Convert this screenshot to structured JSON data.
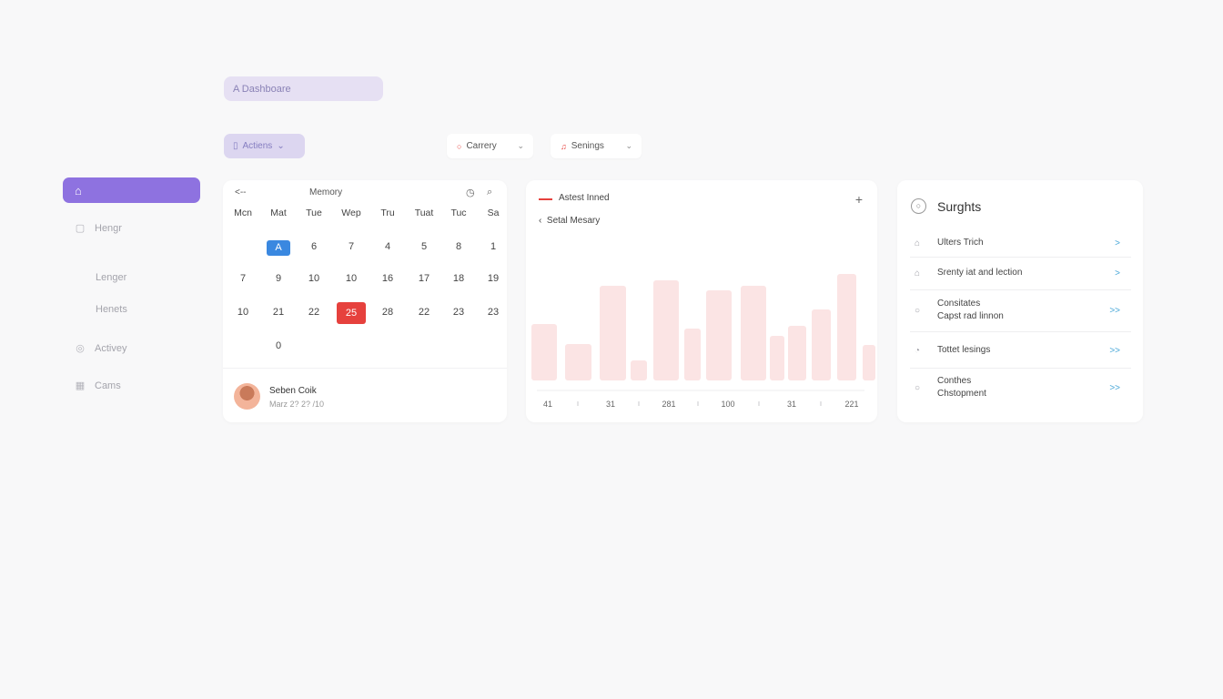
{
  "topbar": {
    "dashboard_label": "A  Dashboare"
  },
  "filters": {
    "actions_label": "Actiens",
    "category_label": "Carrery",
    "settings_label": "Senings"
  },
  "sidebar": {
    "items": [
      {
        "label": "Hengr"
      },
      {
        "label": "Lenger"
      },
      {
        "label": "Henets"
      },
      {
        "label": "Activey"
      },
      {
        "label": "Cams"
      }
    ]
  },
  "calendar": {
    "back_label": "<--",
    "title": "Memory",
    "weekdays": [
      "Mcn",
      "Mat",
      "Tue",
      "Wep",
      "Tru",
      "Tuat",
      "Tuc",
      "Sa"
    ],
    "rows": [
      [
        "",
        "A",
        "6",
        "7",
        "4",
        "5",
        "8",
        "1"
      ],
      [
        "7",
        "9",
        "10",
        "10",
        "16",
        "17",
        "18",
        "19"
      ],
      [
        "10",
        "21",
        "22",
        "25",
        "28",
        "22",
        "23",
        "23"
      ],
      [
        "",
        "0",
        "",
        "",
        "",
        "",
        "",
        ""
      ]
    ],
    "user": {
      "name": "Seben Coik",
      "date": "Marz 2? 2? /10"
    }
  },
  "chart_panel": {
    "legend": "Astest Inned",
    "subtitle": "Setal Mesary",
    "plus": "+"
  },
  "chart_data": {
    "type": "bar",
    "series": [
      {
        "name": "Astest Inned",
        "values": [
          62,
          40,
          104,
          22,
          110,
          57,
          99,
          104,
          49,
          60,
          78,
          117,
          39
        ]
      }
    ],
    "x_tick_labels": [
      "41",
      "31",
      "281",
      "100",
      "31",
      "221"
    ],
    "colors": {
      "bar": "#fbe4e4",
      "accent": "#e6413d"
    }
  },
  "insights": {
    "title": "Surghts",
    "items": [
      {
        "label": "Ulters Trich",
        "arrow": ">"
      },
      {
        "label": "Srenty iat and lection",
        "arrow": ">"
      },
      {
        "label": "Consitates",
        "label2": "Capst rad linnon",
        "arrow": ">>"
      },
      {
        "label": "Tottet lesings",
        "arrow": ">>"
      },
      {
        "label": "Conthes",
        "label2": "Chstopment",
        "arrow": ">>"
      }
    ]
  }
}
